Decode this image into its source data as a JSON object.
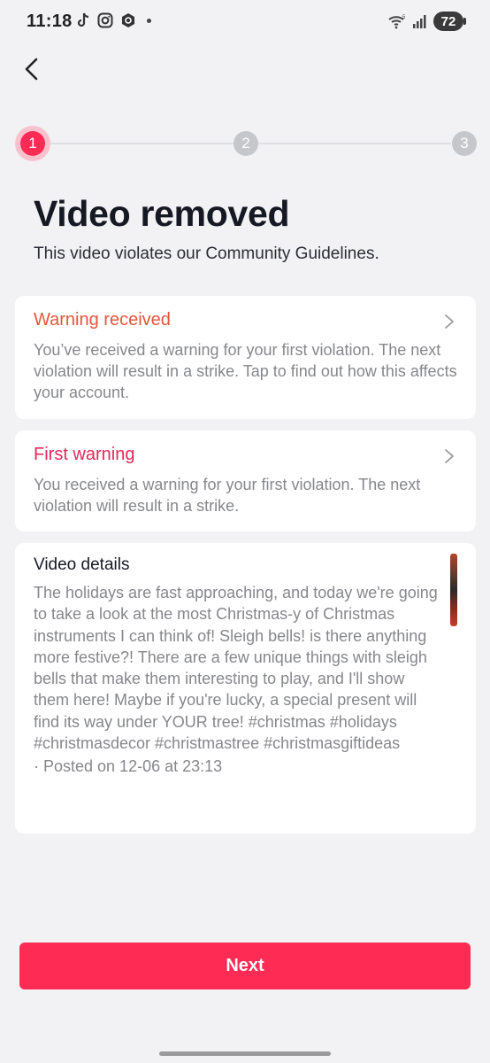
{
  "status_bar": {
    "time": "11:18",
    "battery": "72",
    "icons": [
      "tiktok-icon",
      "instagram-icon",
      "app-icon",
      "wifi-icon",
      "signal-icon"
    ]
  },
  "stepper": {
    "steps": [
      "1",
      "2",
      "3"
    ],
    "active_step": 1,
    "accent_color": "#fe2c55"
  },
  "header": {
    "title": "Video removed",
    "subtitle": "This video violates our Community Guidelines."
  },
  "cards": [
    {
      "title": "Warning received",
      "body": "You’ve received a warning for your first violation. The next violation will result in a strike. Tap to find out how this affects your account.",
      "title_color": "#e5553c"
    },
    {
      "title": "First warning",
      "body": "You received a warning for your first violation. The next violation will result in a strike.",
      "title_color": "#e3275a"
    }
  ],
  "video_details": {
    "title": "Video details",
    "description": "The holidays are fast approaching, and today we're going to take a look at the most Christmas-y of Christmas instruments I can think of! Sleigh bells! is there anything more festive?! There are a few unique things with sleigh bells that make them interesting to play, and I'll show them here! Maybe if you're lucky, a special present will find its way under YOUR tree! #christmas #holidays #christmasdecor #christmastree #christmasgiftideas",
    "posted": "· Posted on 12-06 at 23:13"
  },
  "footer": {
    "next_label": "Next"
  }
}
